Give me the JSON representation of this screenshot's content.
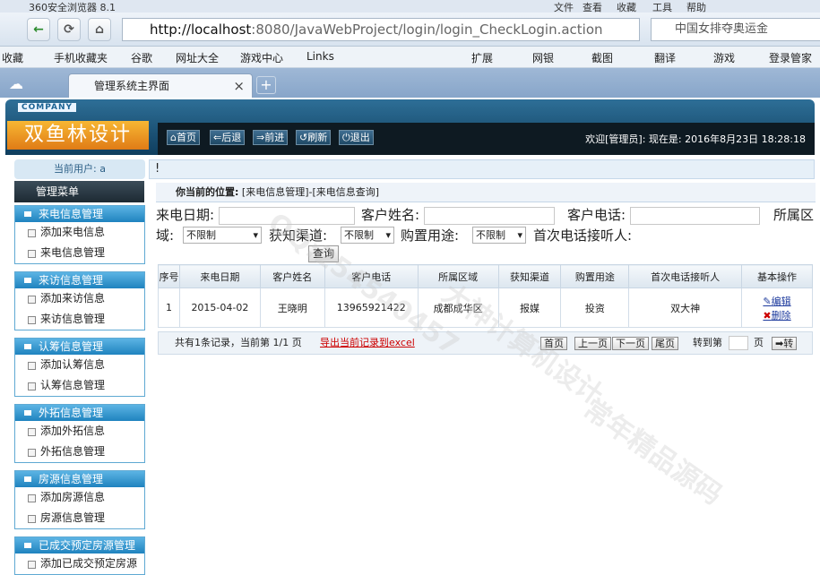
{
  "browser": {
    "title": "360安全浏览器 8.1",
    "menu": [
      "文件",
      "查看",
      "收藏",
      "工具",
      "帮助"
    ],
    "url_host": "http://localhost",
    "url_rest": ":8080/JavaWebProject/login/login_CheckLogin.action",
    "search_text": "中国女排夺奥运金",
    "favorites": [
      "收藏",
      "手机收藏夹",
      "谷歌",
      "网址大全",
      "游戏中心",
      "Links"
    ],
    "tools": [
      "扩展",
      "网银",
      "截图",
      "翻译",
      "游戏",
      "登录管家"
    ],
    "tab_title": "管理系统主界面",
    "tab_close": "×",
    "tab_new": "+"
  },
  "app": {
    "company": "COMPANY",
    "logo": "双鱼林设计",
    "toolbar": {
      "home": "首页",
      "back": "后退",
      "forward": "前进",
      "refresh": "刷新",
      "logout": "退出"
    },
    "welcome": "欢迎[管理员]:    现在是: 2016年8月23日  18:28:18",
    "current_user": "当前用户: a",
    "exclaim": "!"
  },
  "sidebar": {
    "title": "管理菜单",
    "groups": [
      {
        "title": "来电信息管理",
        "items": [
          "添加来电信息",
          "来电信息管理"
        ]
      },
      {
        "title": "来访信息管理",
        "items": [
          "添加来访信息",
          "来访信息管理"
        ]
      },
      {
        "title": "认筹信息管理",
        "items": [
          "添加认筹信息",
          "认筹信息管理"
        ]
      },
      {
        "title": "外拓信息管理",
        "items": [
          "添加外拓信息",
          "外拓信息管理"
        ]
      },
      {
        "title": "房源信息管理",
        "items": [
          "添加房源信息",
          "房源信息管理"
        ]
      },
      {
        "title": "已成交预定房源管理",
        "items": [
          "添加已成交预定房源"
        ]
      }
    ]
  },
  "content": {
    "position_label": "你当前的位置:",
    "position_path": "[来电信息管理]-[来电信息查询]",
    "filters": {
      "date_label": "来电日期:",
      "name_label": "客户姓名:",
      "phone_label": "客户电话:",
      "region_label": "所属区",
      "region_label2": "域:",
      "region_value": "不限制",
      "channel_label": "获知渠道:",
      "channel_value": "不限制",
      "purpose_label": "购置用途:",
      "purpose_value": "不限制",
      "receiver_label": "首次电话接听人:",
      "query_button": "查询"
    },
    "table": {
      "headers": [
        "序号",
        "来电日期",
        "客户姓名",
        "客户电话",
        "所属区域",
        "获知渠道",
        "购置用途",
        "首次电话接听人",
        "基本操作"
      ],
      "rows": [
        [
          "1",
          "2015-04-02",
          "王晓明",
          "13965921422",
          "成都成华区",
          "报媒",
          "投资",
          "双大神"
        ]
      ],
      "edit_label": "编辑",
      "delete_label": "删除"
    },
    "pager": {
      "info": "共有1条记录，当前第 1/1 页",
      "export": "导出当前记录到excel",
      "first": "首页",
      "prev": "上一页",
      "next": "下一页",
      "last": "尾页",
      "goto_label": "转到第",
      "page_suffix": "页",
      "go": "转"
    }
  },
  "watermarks": [
    "QQ:254540457",
    "大神计算机设计",
    "常年精品源码"
  ]
}
